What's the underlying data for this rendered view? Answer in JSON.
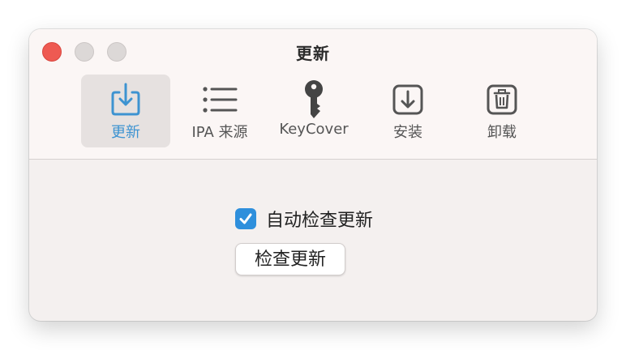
{
  "window": {
    "title": "更新"
  },
  "toolbar": {
    "items": [
      {
        "label": "更新",
        "icon": "download-tray-icon",
        "active": true
      },
      {
        "label": "IPA 来源",
        "icon": "list-icon",
        "active": false
      },
      {
        "label": "KeyCover",
        "icon": "key-icon",
        "active": false
      },
      {
        "label": "安装",
        "icon": "install-arrow-icon",
        "active": false
      },
      {
        "label": "卸载",
        "icon": "trash-icon",
        "active": false
      }
    ]
  },
  "settings": {
    "auto_update_label": "自动检查更新",
    "auto_update_checked": true,
    "check_button_label": "检查更新"
  },
  "colors": {
    "accent": "#3d93d1",
    "checkbox": "#2e8fdc",
    "close": "#ee5a52"
  }
}
